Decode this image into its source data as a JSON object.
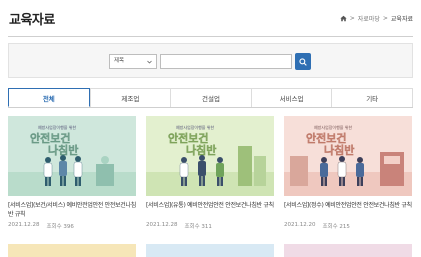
{
  "header": {
    "title": "교육자료",
    "breadcrumb": [
      "자료마당",
      "교육자료"
    ],
    "breadcrumb_sep": ">"
  },
  "search": {
    "select_value": "제목",
    "input_value": "",
    "button_icon": "search-icon"
  },
  "tabs": [
    {
      "label": "전체",
      "active": true
    },
    {
      "label": "제조업",
      "active": false
    },
    {
      "label": "건설업",
      "active": false
    },
    {
      "label": "서비스업",
      "active": false
    },
    {
      "label": "기타",
      "active": false
    }
  ],
  "thumb_text": {
    "small": "예방사업장이행을 위한",
    "main_line1": "안전보건",
    "main_line2": "나침반"
  },
  "cards": [
    {
      "title": "[서비스업](보건/서비스) 예비안전업안전 안전보건나침반 규칙",
      "date": "2021.12.28",
      "views": "조회수 396"
    },
    {
      "title": "[서비스업](유통) 예비안전업안전 안전보건나침반 규칙",
      "date": "2021.12.28",
      "views": "조회수 311"
    },
    {
      "title": "[서비스업](정수) 예비안전업안전 안전보건나침반 규칙",
      "date": "2021.12.20",
      "views": "조회수 215"
    }
  ],
  "colors": {
    "accent": "#2f6fb3",
    "thumb_green": "#cfe7dc",
    "thumb_lime": "#e3f0cf",
    "thumb_pink": "#f7dfd9"
  }
}
